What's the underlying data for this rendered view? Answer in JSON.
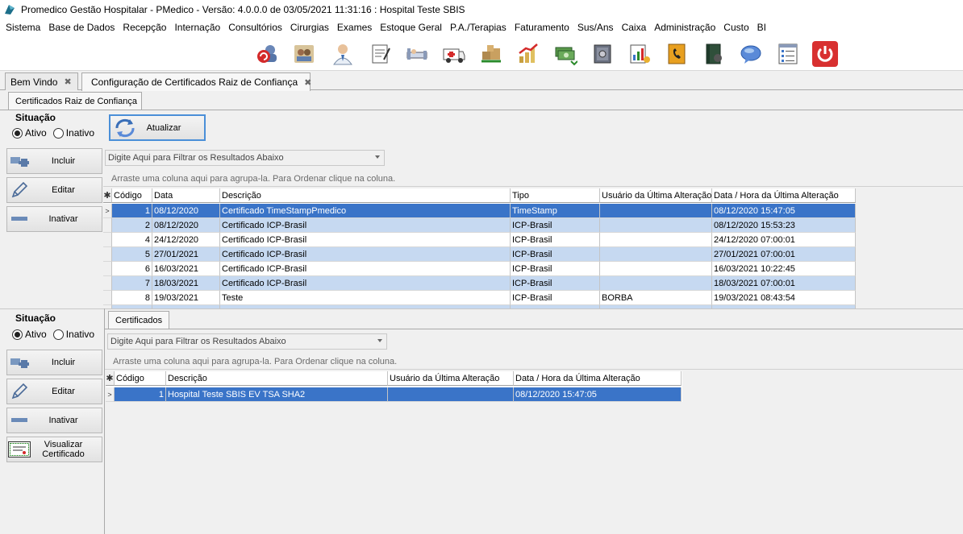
{
  "window": {
    "title": "Promedico Gestão Hospitalar - PMedico - Versão: 4.0.0.0 de 03/05/2021 11:31:16 : Hospital Teste SBIS"
  },
  "menu": [
    "Sistema",
    "Base de Dados",
    "Recepção",
    "Internação",
    "Consultórios",
    "Cirurgias",
    "Exames",
    "Estoque Geral",
    "P.A./Terapias",
    "Faturamento",
    "Sus/Ans",
    "Caixa",
    "Administração",
    "Custo",
    "BI"
  ],
  "toolbar_icons": [
    "refresh-users-icon",
    "users-icon",
    "doctor-icon",
    "prescription-icon",
    "hospital-bed-icon",
    "ambulance-icon",
    "stock-boxes-icon",
    "finance-chart-icon",
    "money-icon",
    "safe-icon",
    "reports-icon",
    "phone-book-icon",
    "book-icon",
    "chat-bubble-icon",
    "checklist-icon",
    "power-icon"
  ],
  "doc_tabs": [
    {
      "label": "Bem Vindo",
      "close": "✖"
    },
    {
      "label": "Configuração de Certificados Raiz de Confiança",
      "close": "✖"
    }
  ],
  "top": {
    "tab": "Certificados Raiz de Confiança",
    "situacao_label": "Situação",
    "radio_ativo": "Ativo",
    "radio_inativo": "Inativo",
    "refresh_label": "Atualizar",
    "btn_incluir": "Incluir",
    "btn_editar": "Editar",
    "btn_inativar": "Inativar",
    "filter_placeholder": "Digite Aqui para Filtrar os Resultados Abaixo",
    "group_hint": "Arraste uma coluna aqui para agrupa-la. Para Ordenar clique na coluna.",
    "columns": [
      "Código",
      "Data",
      "Descrição",
      "Tipo",
      "Usuário da Última Alteração",
      "Data / Hora da Última Alteração"
    ],
    "rows": [
      [
        "1",
        "08/12/2020",
        "Certificado TimeStampPmedico",
        "TimeStamp",
        "",
        "08/12/2020 15:47:05"
      ],
      [
        "2",
        "08/12/2020",
        "Certificado ICP-Brasil",
        "ICP-Brasil",
        "",
        "08/12/2020 15:53:23"
      ],
      [
        "4",
        "24/12/2020",
        "Certificado ICP-Brasil",
        "ICP-Brasil",
        "",
        "24/12/2020 07:00:01"
      ],
      [
        "5",
        "27/01/2021",
        "Certificado ICP-Brasil",
        "ICP-Brasil",
        "",
        "27/01/2021 07:00:01"
      ],
      [
        "6",
        "16/03/2021",
        "Certificado ICP-Brasil",
        "ICP-Brasil",
        "",
        "16/03/2021 10:22:45"
      ],
      [
        "7",
        "18/03/2021",
        "Certificado ICP-Brasil",
        "ICP-Brasil",
        "",
        "18/03/2021 07:00:01"
      ],
      [
        "8",
        "19/03/2021",
        "Teste",
        "ICP-Brasil",
        "BORBA",
        "19/03/2021 08:43:54"
      ]
    ]
  },
  "bottom": {
    "tab": "Certificados",
    "situacao_label": "Situação",
    "radio_ativo": "Ativo",
    "radio_inativo": "Inativo",
    "btn_incluir": "Incluir",
    "btn_editar": "Editar",
    "btn_inativar": "Inativar",
    "btn_visualizar": "Visualizar Certificado",
    "filter_placeholder": "Digite Aqui para Filtrar os Resultados Abaixo",
    "group_hint": "Arraste uma coluna aqui para agrupa-la. Para Ordenar clique na coluna.",
    "columns": [
      "Código",
      "Descrição",
      "Usuário da Última Alteração",
      "Data / Hora da Última Alteração"
    ],
    "rows": [
      [
        "1",
        "Hospital Teste SBIS EV TSA SHA2",
        "",
        "08/12/2020 15:47:05"
      ]
    ]
  },
  "colors": {
    "selected_row": "#3a74c8",
    "alt_row": "#c6d9f1",
    "focus_border": "#4a8fd8"
  }
}
